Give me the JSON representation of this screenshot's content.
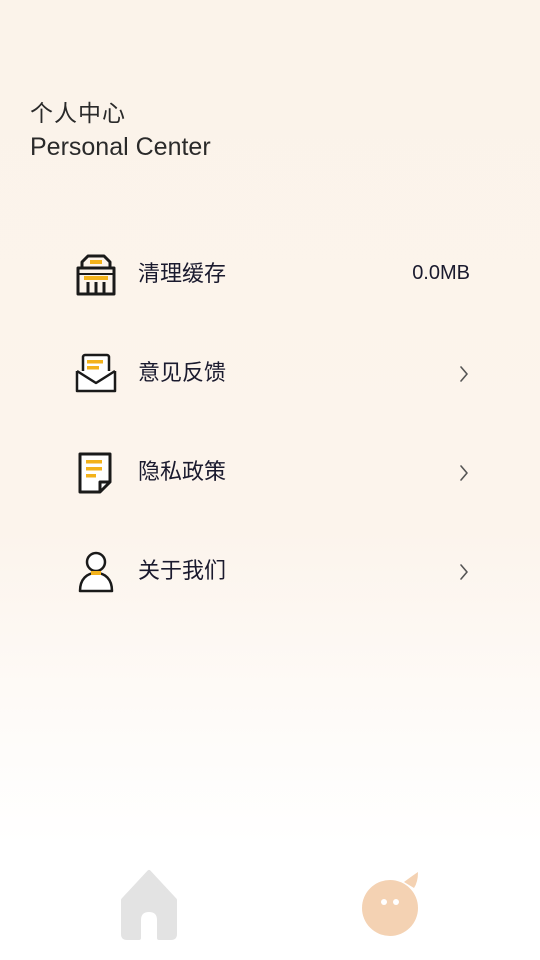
{
  "header": {
    "title_cn": "个人中心",
    "title_en": "Personal Center"
  },
  "menu": {
    "items": [
      {
        "icon": "cache-cleanup-icon",
        "label": "清理缓存",
        "value": "0.0MB"
      },
      {
        "icon": "feedback-envelope-icon",
        "label": "意见反馈"
      },
      {
        "icon": "privacy-document-icon",
        "label": "隐私政策"
      },
      {
        "icon": "about-person-icon",
        "label": "关于我们"
      }
    ]
  },
  "tabbar": {
    "tabs": [
      {
        "icon": "home-icon",
        "active": false
      },
      {
        "icon": "mine-mascot-icon",
        "active": true
      }
    ]
  },
  "colors": {
    "accent": "#f3b21a",
    "icon_stroke": "#1a1a1a",
    "tab_inactive": "#e3e3e3",
    "tab_active": "#f4d2b3"
  }
}
